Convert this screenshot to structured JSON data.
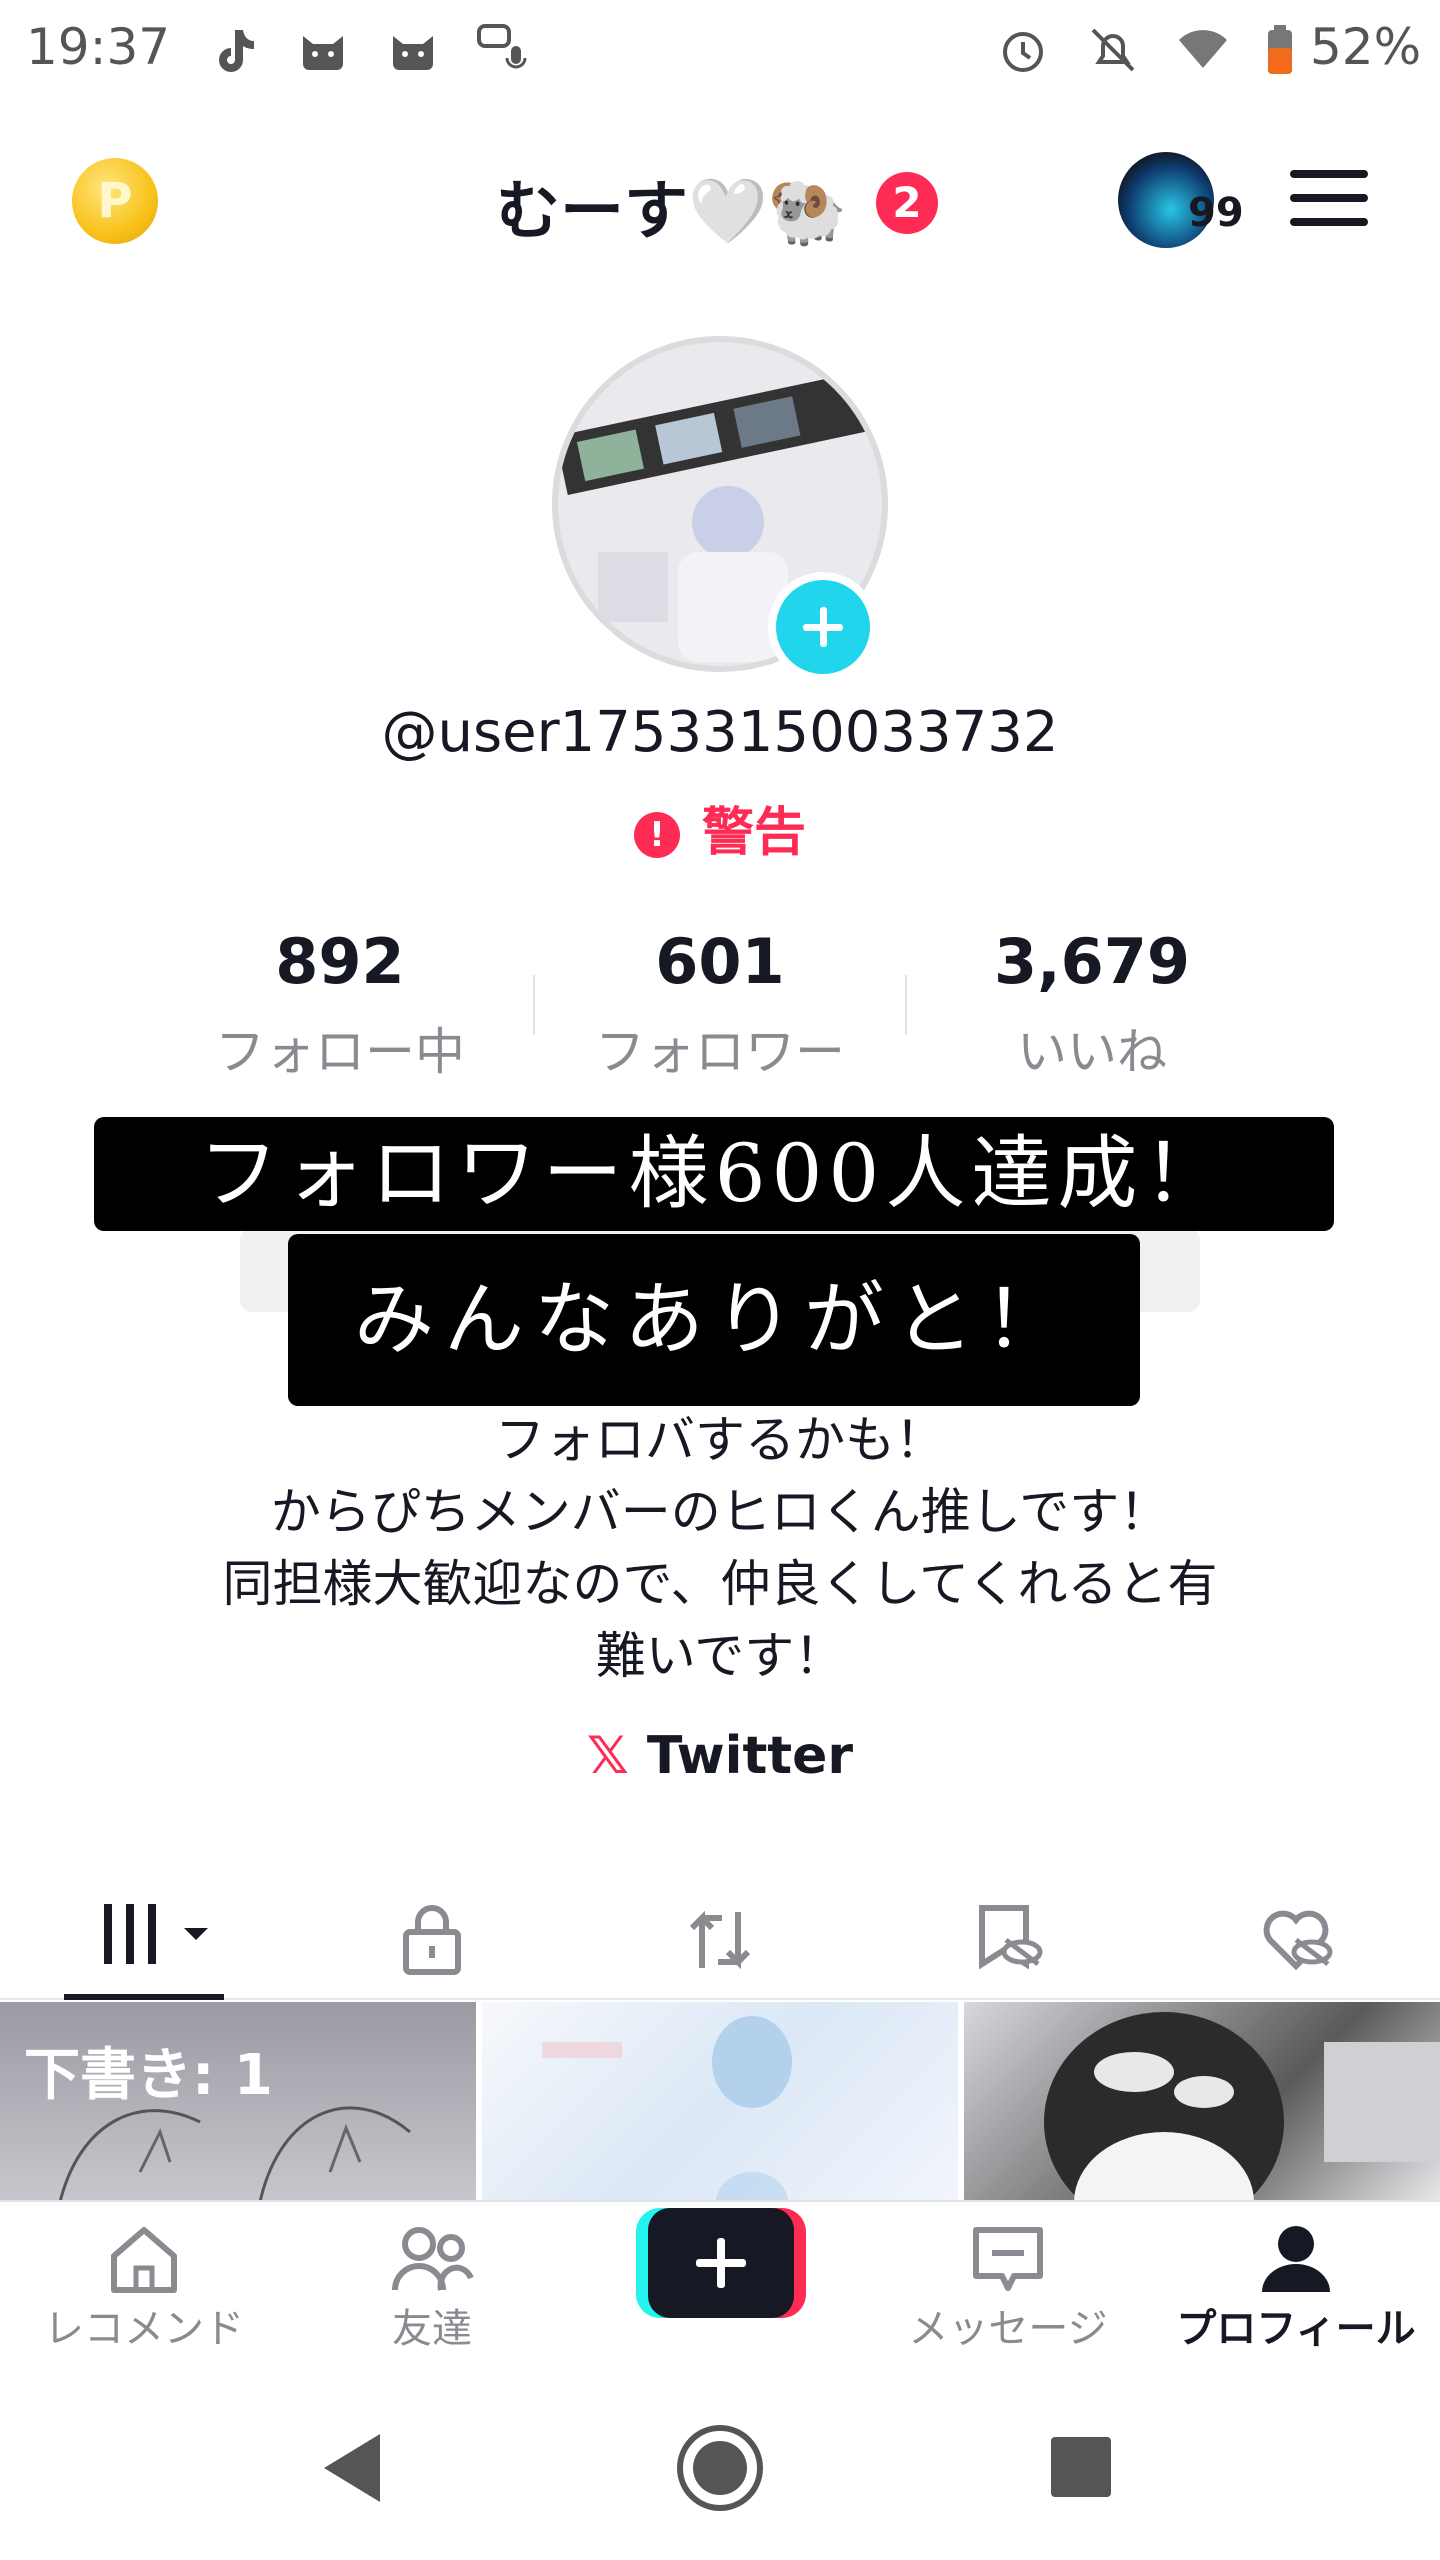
{
  "status_bar": {
    "time": "19:37",
    "battery_percent": "52%",
    "icons": [
      "tiktok-icon",
      "cat-icon",
      "cat-icon",
      "voice-chat-icon",
      "alarm-icon",
      "mute-icon",
      "wifi-icon",
      "battery-icon"
    ]
  },
  "header": {
    "title": "むーす🤍🐏",
    "notification_badge": "2",
    "avatar_count": "99",
    "coin_letter": "P"
  },
  "profile": {
    "username": "@user17533150033732",
    "warning_text": "警告",
    "warning_mark": "!"
  },
  "stats": [
    {
      "value": "892",
      "label": "フォロー中"
    },
    {
      "value": "601",
      "label": "フォロワー"
    },
    {
      "value": "3,679",
      "label": "いいね"
    }
  ],
  "overlay": {
    "line1": "フォロワー様600人達成！",
    "line2": "みんなありがと！"
  },
  "bio": {
    "line1": "フォロバするかも！",
    "line2": "からぴちメンバーのヒロくん推しです！",
    "line3": "同担様大歓迎なので、仲良くしてくれると有",
    "line4": "難いです！"
  },
  "link": {
    "label": "Twitter",
    "icon": "x-logo-icon"
  },
  "tabs": [
    {
      "name": "videos-grid-icon",
      "active": true
    },
    {
      "name": "lock-icon",
      "active": false
    },
    {
      "name": "repost-icon",
      "active": false
    },
    {
      "name": "bookmark-hidden-icon",
      "active": false
    },
    {
      "name": "liked-hidden-icon",
      "active": false
    }
  ],
  "grid": {
    "draft_label": "下書き: 1"
  },
  "bottom_nav": [
    {
      "label": "レコメンド",
      "icon": "home-icon"
    },
    {
      "label": "友達",
      "icon": "friends-icon"
    },
    {
      "label": "",
      "icon": "create-icon"
    },
    {
      "label": "メッセージ",
      "icon": "message-icon"
    },
    {
      "label": "プロフィール",
      "icon": "profile-icon"
    }
  ],
  "colors": {
    "accent_red": "#fe2c55",
    "accent_cyan": "#20d5ec",
    "text_primary": "#161823",
    "text_secondary": "#8a8b91"
  }
}
